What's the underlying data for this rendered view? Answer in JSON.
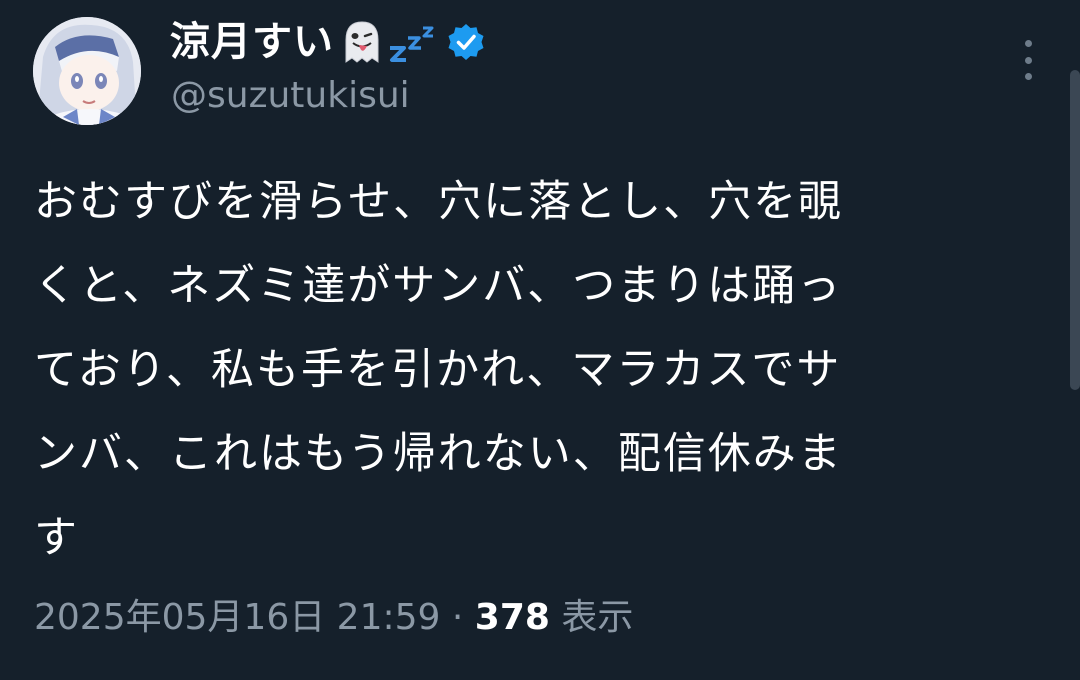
{
  "user": {
    "display_name": "涼月すい",
    "handle": "@suzutukisui",
    "emoji_1": "ghost-tongue-emoji",
    "emoji_2": "zzz-emoji",
    "verified": true
  },
  "tweet": {
    "lines": [
      "おむすびを滑らせ、穴に落とし、穴を覗",
      "くと、ネズミ達がサンバ、つまりは踊っ",
      "ており、私も手を引かれ、マラカスでサ",
      "ンバ、これはもう帰れない、配信休みま",
      "す"
    ]
  },
  "meta": {
    "timestamp": "2025年05月16日 21:59",
    "separator": "·",
    "views_count": "378",
    "views_label": "表示"
  },
  "colors": {
    "background": "#15202b",
    "secondary_text": "#8b98a5",
    "verified_blue": "#1d9bf0"
  }
}
